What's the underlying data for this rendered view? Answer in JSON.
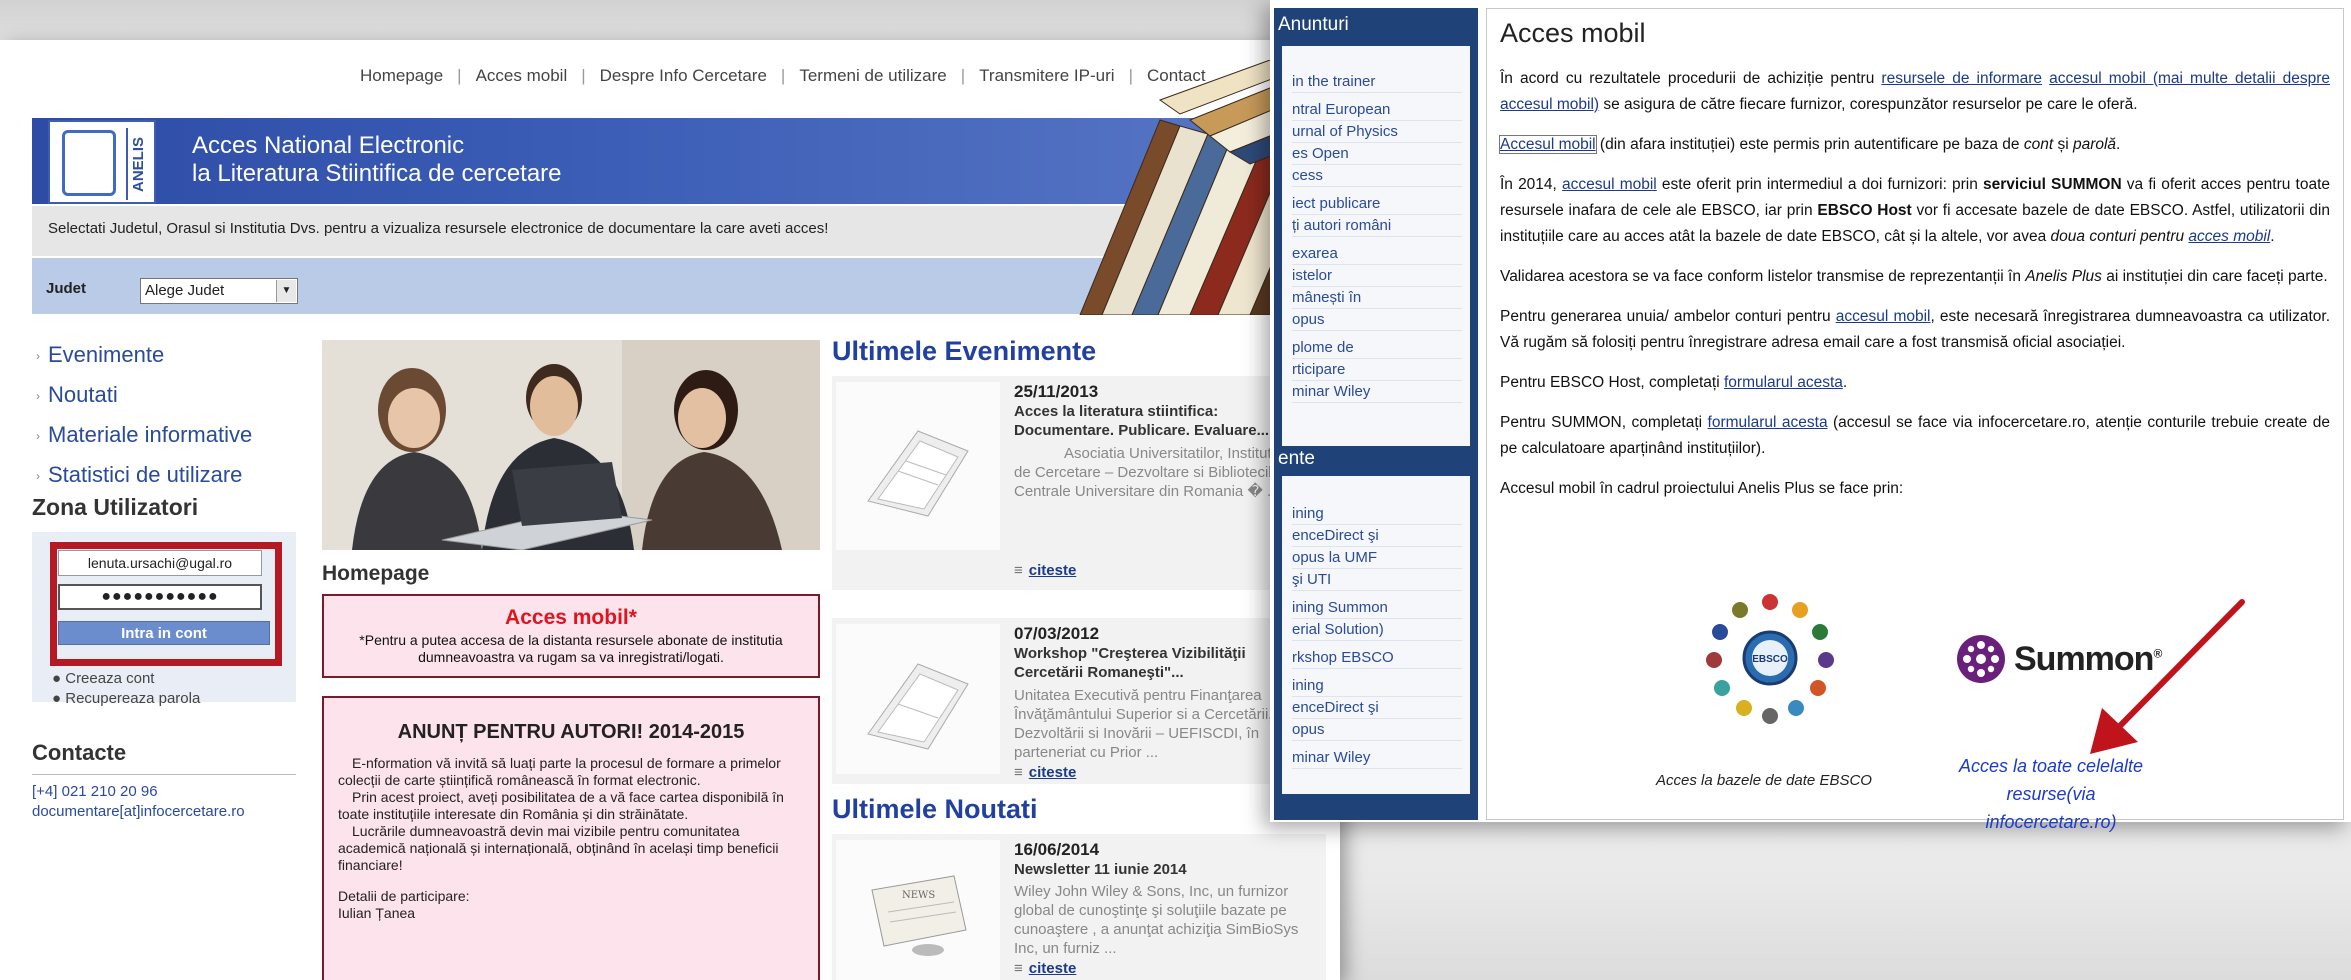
{
  "left": {
    "nav": [
      "Homepage",
      "Acces mobil",
      "Despre Info Cercetare",
      "Termeni de utilizare",
      "Transmitere IP-uri",
      "Contact"
    ],
    "logo_text": "ANELIS",
    "banner_line1": "Acces National Electronic",
    "banner_line2": "la Literatura Stiintifica de cercetare",
    "info": "Selectati Judetul, Orasul si Institutia Dvs. pentru a vizualiza resursele electronice de documentare la care aveti acces!",
    "judet_label": "Judet",
    "judet_selected": "Alege Judet",
    "sidebar": [
      "Evenimente",
      "Noutati",
      "Materiale informative",
      "Statistici de utilizare"
    ],
    "zona_title": "Zona Utilizatori",
    "login_email": "lenuta.ursachi@ugal.ro",
    "login_password": "●●●●●●●●●●●",
    "login_button": "Intra in cont",
    "create_account": "Creeaza cont",
    "recover_password": "Recupereaza parola",
    "contact_title": "Contacte",
    "phone": "[+4] 021 210 20 96",
    "email": "documentare[at]infocercetare.ro",
    "homepage_title": "Homepage",
    "mobil_title": "Acces mobil*",
    "mobil_text": "*Pentru a putea accesa de la distanta resursele abonate de institutia dumneavoastra va rugam sa va inregistrati/logati.",
    "anunt_title": "ANUNȚ PENTRU AUTORI! 2014-2015",
    "anunt_p1": "E-nformation vă invită să luați parte la procesul de formare a primelor colecții de carte științifică românească în format electronic.",
    "anunt_p2": "Prin acest proiect, aveți posibilitatea de a vă face cartea disponibilă în toate instituțiile interesate din România și din străinătate.",
    "anunt_p3": "Lucrările dumneavoastră devin mai vizibile pentru comunitatea academică națională și internațională, obținând în același timp beneficii financiare!",
    "anunt_p4": "Detalii de participare:",
    "anunt_p5": "Iulian Țanea",
    "events_title": "Ultimele Evenimente",
    "event1_date": "25/11/2013",
    "event1_title": "Acces la literatura stiintifica: Documentare. Publicare. Evaluare....",
    "event1_desc": "Asociatia Universitatilor, Institutelor de Cercetare – Dezvoltare si Bibliotecilor Centrale Universitare din Romania � ...",
    "event2_date": "07/03/2012",
    "event2_title": "Workshop \"Creşterea Vizibilităţii Cercetării Romaneşti\"...",
    "event2_desc": "Unitatea Executivă pentru Finanţarea Învăţământului Superior si a Cercetării, Dezvoltării si Inovării – UEFISCDI, în parteneriat cu Prior ...",
    "news_title": "Ultimele Noutati",
    "news1_date": "16/06/2014",
    "news1_title": "Newsletter 11 iunie 2014",
    "news1_desc": "Wiley John Wiley & Sons, Inc, un furnizor global de cunoştinţe şi soluţiile bazate pe cunoaştere , a anunţat achiziţia SimBioSys Inc, un furniz ...",
    "read_more": "citeste"
  },
  "right": {
    "anunturi": "Anunturi",
    "anunturi_items": [
      "in the trainer",
      "ntral European",
      "urnal of Physics",
      "es Open",
      "cess",
      "iect publicare",
      "ți autori români",
      "exarea",
      "istelor",
      "mânești în",
      "opus",
      "plome de",
      "rticipare",
      "minar Wiley"
    ],
    "evenimente": "ente",
    "evenimente_items": [
      "ining",
      "enceDirect şi",
      "opus la UMF",
      "şi UTI",
      "ining Summon",
      "erial Solution)",
      "rkshop EBSCO",
      "ining",
      "enceDirect şi",
      "opus",
      "minar Wiley"
    ],
    "title": "Acces mobil",
    "p1_a": "În acord cu rezultatele procedurii de achiziție pentru ",
    "p1_link1": "resursele de informare",
    "p1_link2": "accesul mobil (mai multe detalii despre accesul mobil)",
    "p1_b": " se asigura de către fiecare furnizor, corespunzător resurselor pe care le oferă.",
    "p2_link": "Accesul mobil",
    "p2_a": " (din afara instituției) este permis prin autentificare pe baza de ",
    "p2_cont": "cont",
    "p2_si": " și ",
    "p2_parola": "parolă",
    "p2_end": ".",
    "p3_a": "În 2014, ",
    "p3_link": "accesul mobil",
    "p3_b": " este oferit prin intermediul a doi furnizori: prin ",
    "p3_summon": "serviciul SUMMON",
    "p3_c": " va fi oferit acces pentru toate resursele inafara de cele ale EBSCO, iar prin ",
    "p3_ebsco": "EBSCO Host",
    "p3_d": " vor fi accesate bazele de date EBSCO. Astfel, utilizatorii din instituțiile care au acces atât la bazele de date EBSCO, cât și la altele, vor avea ",
    "p3_doua": "doua conturi pentru ",
    "p3_link2": "acces mobil",
    "p3_end": ".",
    "p4_a": "Validarea acestora se va face conform listelor transmise de reprezentanții în ",
    "p4_anelis": "Anelis Plus",
    "p4_b": " ai instituției din care faceți parte.",
    "p5_a": "Pentru generarea unuia/ ambelor conturi pentru ",
    "p5_link": "accesul mobil",
    "p5_b": ", este necesară înregistrarea dumneavoastra ca utilizator. Vă rugăm să folosiți pentru înregistrare adresa email care a fost transmisă oficial asociației.",
    "p6_a": "Pentru EBSCO Host, completați ",
    "p6_link": "formularul acesta",
    "p6_end": ".",
    "p7_a": "Pentru SUMMON, completați ",
    "p7_link": "formularul acesta",
    "p7_b": " (accesul se face via infocercetare.ro, atenție conturile trebuie create de pe calculatoare aparținând instituțiilor).",
    "p8": "Accesul mobil în cadrul proiectului Anelis Plus se face prin:",
    "ebsco_caption": "Acces la bazele de date EBSCO",
    "summon_logo_text": "Summon",
    "acces_link": "Acces la toate celelalte resurse",
    "acces_via": "(via infocercetare.ro)",
    "arrow_color": "#c0141c"
  }
}
